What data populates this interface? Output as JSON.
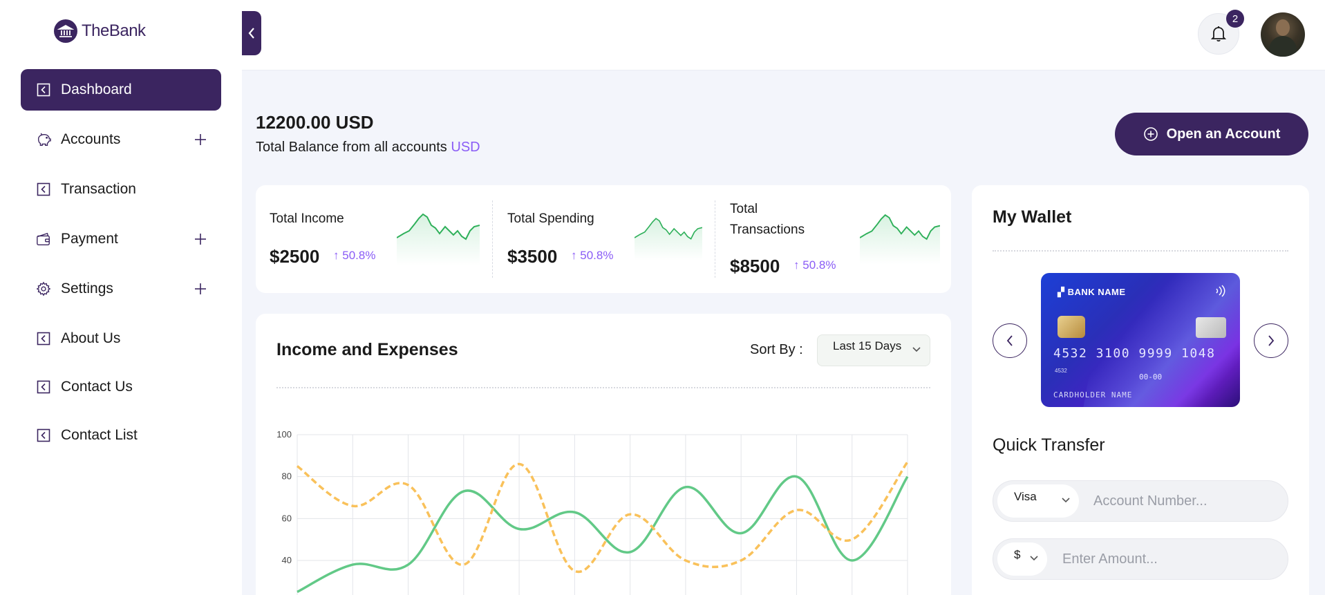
{
  "brand": {
    "name": "TheBank",
    "icon": "bank-icon"
  },
  "sidebar": {
    "items": [
      {
        "label": "Dashboard",
        "icon": "dashboard-icon",
        "active": true,
        "expandable": false
      },
      {
        "label": "Accounts",
        "icon": "piggy-bank-icon",
        "active": false,
        "expandable": true
      },
      {
        "label": "Transaction",
        "icon": "transaction-icon",
        "active": false,
        "expandable": false
      },
      {
        "label": "Payment",
        "icon": "wallet-icon",
        "active": false,
        "expandable": true
      },
      {
        "label": "Settings",
        "icon": "gear-icon",
        "active": false,
        "expandable": true
      },
      {
        "label": "About Us",
        "icon": "about-icon",
        "active": false,
        "expandable": false
      },
      {
        "label": "Contact Us",
        "icon": "contact-icon",
        "active": false,
        "expandable": false
      },
      {
        "label": "Contact List",
        "icon": "contact-list-icon",
        "active": false,
        "expandable": false
      }
    ]
  },
  "header": {
    "notification_count": "2"
  },
  "balance": {
    "amount": "12200.00 USD",
    "subtitle": "Total Balance from all accounts",
    "currency": "USD",
    "open_account_label": "Open an Account"
  },
  "stats": [
    {
      "label": "Total Income",
      "value": "$2500",
      "change": "50.8%"
    },
    {
      "label": "Total Spending",
      "value": "$3500",
      "change": "50.8%"
    },
    {
      "label": "Total Transactions",
      "value": "$8500",
      "change": "50.8%"
    }
  ],
  "income_expenses": {
    "title": "Income and Expenses",
    "sort_label": "Sort By :",
    "sort_value": "Last 15 Days"
  },
  "chart_data": {
    "type": "line",
    "title": "Income and Expenses",
    "xlabel": "",
    "ylabel": "",
    "y_ticks": [
      40,
      60,
      80,
      100
    ],
    "ylim": [
      20,
      100
    ],
    "grid": true,
    "x": [
      0,
      1,
      2,
      3,
      4,
      5,
      6,
      7,
      8,
      9,
      10,
      11
    ],
    "series": [
      {
        "style": "solid",
        "color": "#62c987",
        "values": [
          25,
          38,
          38,
          73,
          55,
          63,
          44,
          75,
          53,
          80,
          40,
          80
        ]
      },
      {
        "style": "dashed",
        "color": "#f9c15a",
        "values": [
          85,
          66,
          76,
          38,
          86,
          35,
          62,
          40,
          40,
          64,
          50,
          87
        ]
      }
    ]
  },
  "wallet": {
    "title": "My Wallet",
    "card": {
      "bank_name": "BANK NAME",
      "number": "4532 3100 9999 1048",
      "small_number": "4532",
      "expiry": "00-00",
      "holder": "CARDHOLDER NAME"
    }
  },
  "quick_transfer": {
    "title": "Quick Transfer",
    "card_type": "Visa",
    "account_placeholder": "Account Number...",
    "currency": "$",
    "amount_placeholder": "Enter Amount..."
  },
  "colors": {
    "primary": "#3b2560",
    "accent": "#8a5cf6",
    "income_line": "#62c987",
    "expense_line": "#f9c15a",
    "background": "#f3f5fb"
  }
}
